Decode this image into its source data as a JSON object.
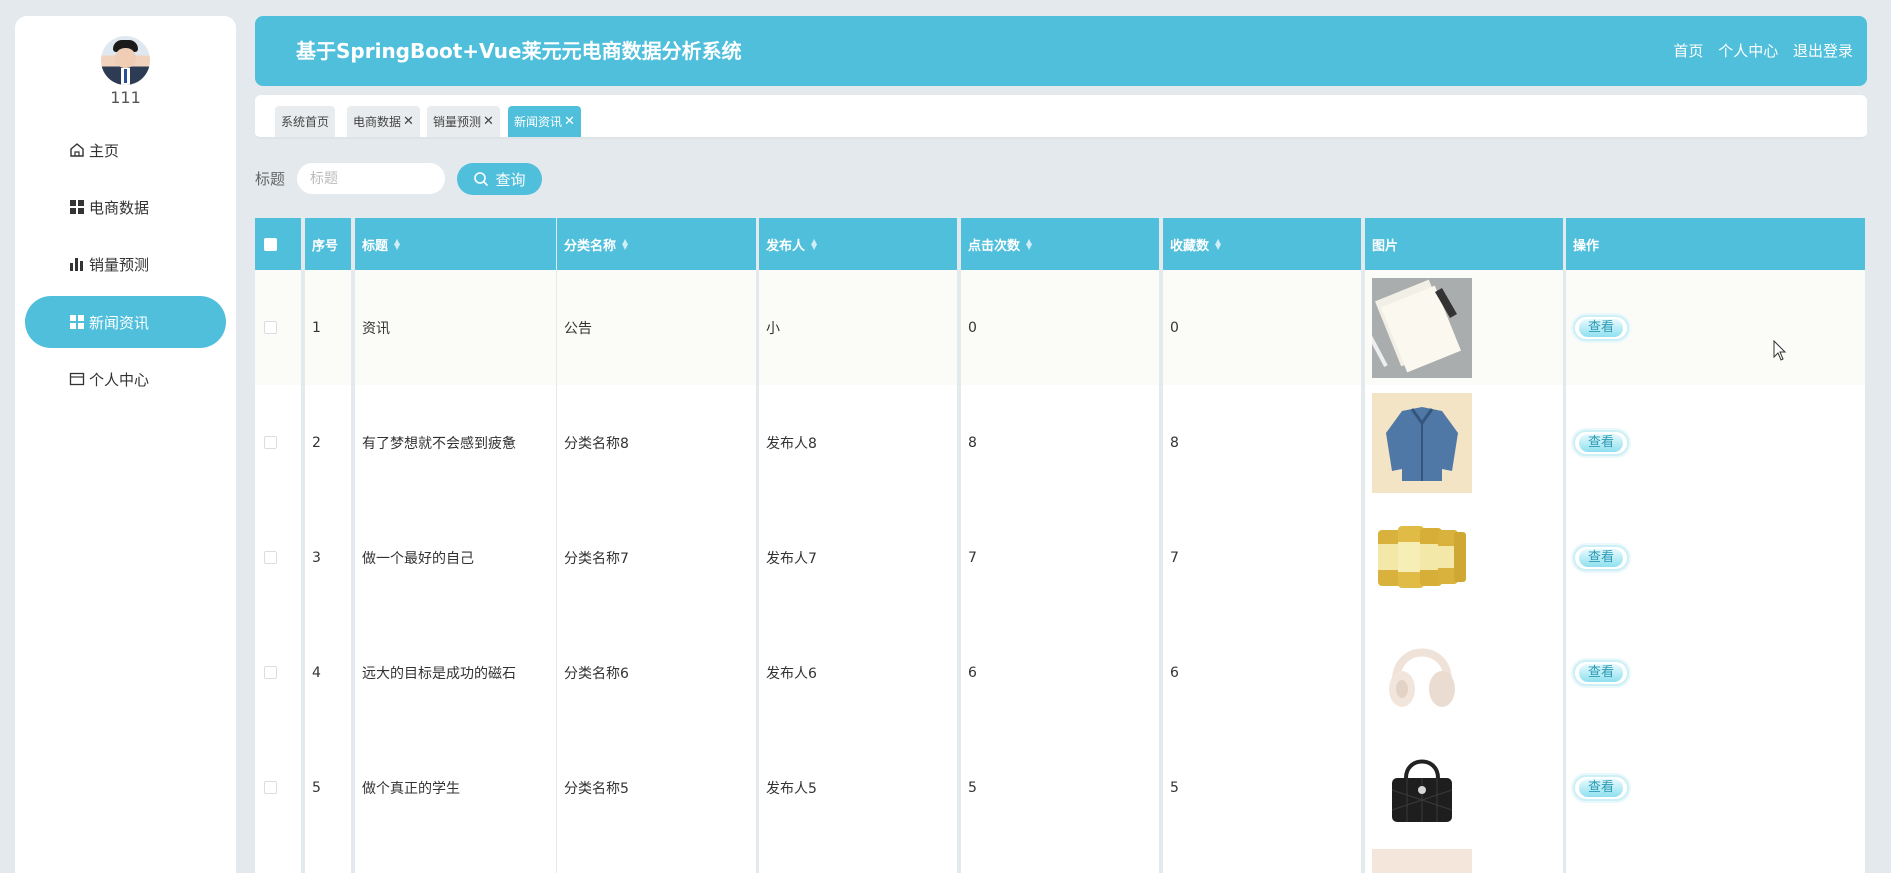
{
  "sidebar": {
    "username": "111",
    "items": [
      {
        "label": "主页",
        "icon": "home-icon"
      },
      {
        "label": "电商数据",
        "icon": "grid-icon"
      },
      {
        "label": "销量预测",
        "icon": "bar-chart-icon"
      },
      {
        "label": "新闻资讯",
        "icon": "grid-icon",
        "active": true
      },
      {
        "label": "个人中心",
        "icon": "card-icon"
      }
    ]
  },
  "header": {
    "title": "基于SpringBoot+Vue莱元元电商数据分析系统",
    "links": [
      "首页",
      "个人中心",
      "退出登录"
    ]
  },
  "tabs": [
    {
      "label": "系统首页",
      "closable": false
    },
    {
      "label": "电商数据",
      "closable": true
    },
    {
      "label": "销量预测",
      "closable": true
    },
    {
      "label": "新闻资讯",
      "closable": true,
      "active": true
    }
  ],
  "search": {
    "label": "标题",
    "placeholder": "标题",
    "button": "查询"
  },
  "table": {
    "columns": [
      "序号",
      "标题",
      "分类名称",
      "发布人",
      "点击次数",
      "收藏数",
      "图片",
      "操作"
    ],
    "rows": [
      {
        "index": "1",
        "title": "资讯",
        "category": "公告",
        "publisher": "小",
        "clicks": "0",
        "favorites": "0",
        "image": "notebook-image",
        "action": "查看"
      },
      {
        "index": "2",
        "title": "有了梦想就不会感到疲惫",
        "category": "分类名称8",
        "publisher": "发布人8",
        "clicks": "8",
        "favorites": "8",
        "image": "denim-jacket-image",
        "action": "查看"
      },
      {
        "index": "3",
        "title": "做一个最好的自己",
        "category": "分类名称7",
        "publisher": "发布人7",
        "clicks": "7",
        "favorites": "7",
        "image": "milk-powder-cans-image",
        "action": "查看"
      },
      {
        "index": "4",
        "title": "远大的目标是成功的磁石",
        "category": "分类名称6",
        "publisher": "发布人6",
        "clicks": "6",
        "favorites": "6",
        "image": "headphones-image",
        "action": "查看"
      },
      {
        "index": "5",
        "title": "做个真正的学生",
        "category": "分类名称5",
        "publisher": "发布人5",
        "clicks": "5",
        "favorites": "5",
        "image": "handbag-image",
        "action": "查看"
      }
    ]
  },
  "colors": {
    "accent": "#4fbfdb",
    "background": "#e3e9ec"
  }
}
